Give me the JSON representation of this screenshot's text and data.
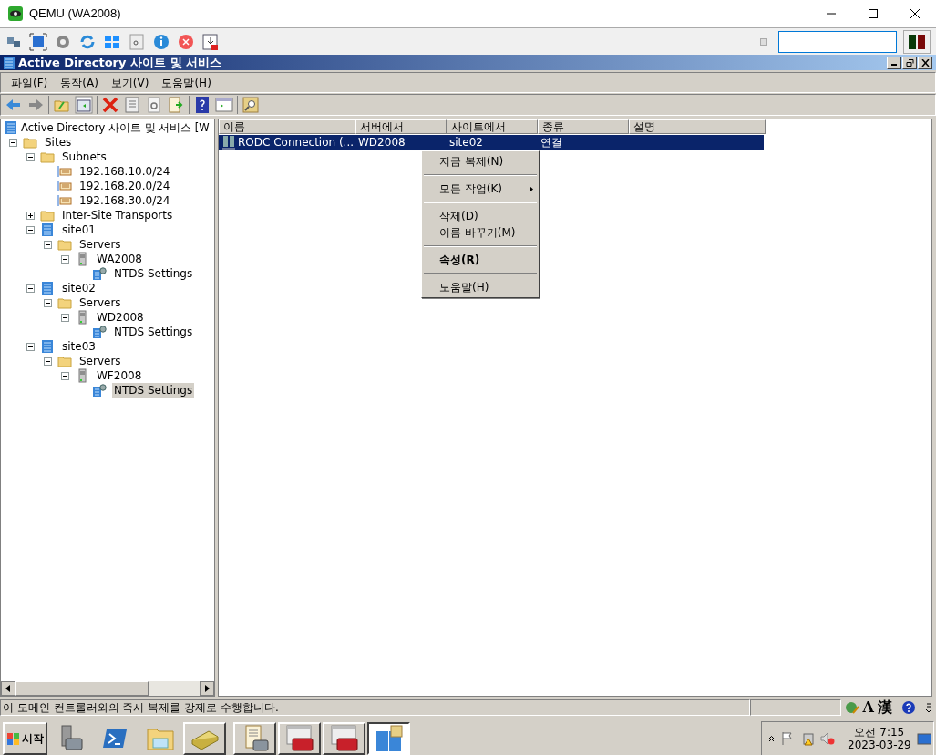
{
  "host_window": {
    "title": "QEMU (WA2008)",
    "toolbar_checkbox": {
      "checked": false
    }
  },
  "mmc": {
    "title": "Active Directory 사이트 및 서비스",
    "menu": [
      "파일(F)",
      "동작(A)",
      "보기(V)",
      "도움말(H)"
    ],
    "tree": {
      "label": "Active Directory 사이트 및 서비스 [W",
      "children": [
        {
          "label": "Sites",
          "kind": "folder",
          "expanded": true,
          "selected": false,
          "children": [
            {
              "label": "Subnets",
              "kind": "folder",
              "expanded": true,
              "selected": false,
              "children": [
                {
                  "label": "192.168.10.0/24",
                  "kind": "subnet",
                  "selected": false
                },
                {
                  "label": "192.168.20.0/24",
                  "kind": "subnet",
                  "selected": false
                },
                {
                  "label": "192.168.30.0/24",
                  "kind": "subnet",
                  "selected": false
                }
              ]
            },
            {
              "label": "Inter-Site Transports",
              "kind": "folder",
              "expanded": false,
              "selected": false
            },
            {
              "label": "site01",
              "kind": "site",
              "expanded": true,
              "selected": false,
              "children": [
                {
                  "label": "Servers",
                  "kind": "folder",
                  "expanded": true,
                  "selected": false,
                  "children": [
                    {
                      "label": "WA2008",
                      "kind": "server",
                      "expanded": true,
                      "selected": false,
                      "children": [
                        {
                          "label": "NTDS Settings",
                          "kind": "ntds",
                          "selected": false
                        }
                      ]
                    }
                  ]
                }
              ]
            },
            {
              "label": "site02",
              "kind": "site",
              "expanded": true,
              "selected": false,
              "children": [
                {
                  "label": "Servers",
                  "kind": "folder",
                  "expanded": true,
                  "selected": false,
                  "children": [
                    {
                      "label": "WD2008",
                      "kind": "server",
                      "expanded": true,
                      "selected": false,
                      "children": [
                        {
                          "label": "NTDS Settings",
                          "kind": "ntds",
                          "selected": false
                        }
                      ]
                    }
                  ]
                }
              ]
            },
            {
              "label": "site03",
              "kind": "site",
              "expanded": true,
              "selected": false,
              "children": [
                {
                  "label": "Servers",
                  "kind": "folder",
                  "expanded": true,
                  "selected": false,
                  "children": [
                    {
                      "label": "WF2008",
                      "kind": "server",
                      "expanded": true,
                      "selected": false,
                      "children": [
                        {
                          "label": "NTDS Settings",
                          "kind": "ntds",
                          "selected": true
                        }
                      ]
                    }
                  ]
                }
              ]
            }
          ]
        }
      ]
    },
    "table": {
      "columns": [
        "이름",
        "서버에서",
        "사이트에서",
        "종류",
        "설명"
      ],
      "rows": [
        {
          "cells": [
            "RODC Connection (...",
            "WD2008",
            "site02",
            "연결"
          ],
          "selected": true
        }
      ]
    },
    "context_menu": [
      {
        "kind": "item",
        "label": "지금 복제(N)"
      },
      {
        "kind": "separator"
      },
      {
        "kind": "submenu",
        "label": "모든 작업(K)"
      },
      {
        "kind": "separator"
      },
      {
        "kind": "item",
        "label": "삭제(D)"
      },
      {
        "kind": "item",
        "label": "이름 바꾸기(M)"
      },
      {
        "kind": "separator"
      },
      {
        "kind": "default",
        "label": "속성(R)"
      },
      {
        "kind": "separator"
      },
      {
        "kind": "item",
        "label": "도움말(H)"
      }
    ],
    "status_bar": {
      "text": "이 도메인 컨트롤러와의 즉시 복제를 강제로 수행합니다.",
      "ime": [
        "A",
        "漢"
      ]
    }
  },
  "taskbar": {
    "start": "시작",
    "buttons": [
      {
        "kind": "server-toolbox",
        "selected": false
      },
      {
        "kind": "shell",
        "selected": false
      },
      {
        "kind": "explorer",
        "selected": false
      },
      {
        "kind": "book",
        "selected": false
      },
      {
        "kind": "scroll-toolbox",
        "selected": false
      },
      {
        "kind": "window-toolbox",
        "selected": false
      },
      {
        "kind": "window-toolbox",
        "selected": false
      },
      {
        "kind": "sites",
        "selected": true
      }
    ],
    "clock": {
      "time": "오전 7:15",
      "date": "2023-03-29"
    }
  }
}
